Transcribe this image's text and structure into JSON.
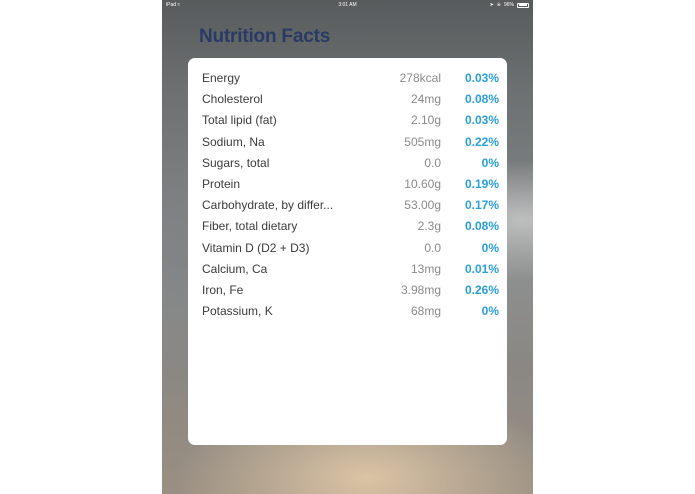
{
  "status_bar": {
    "device": "iPad",
    "wifi_icon": "wifi-icon",
    "time": "3:01 AM",
    "battery_percent": "96%",
    "battery_level": 0.96
  },
  "page": {
    "title": "Nutrition Facts"
  },
  "nutrients": [
    {
      "name": "Energy",
      "amount": "278kcal",
      "percent": "0.03%"
    },
    {
      "name": "Cholesterol",
      "amount": "24mg",
      "percent": "0.08%"
    },
    {
      "name": "Total lipid (fat)",
      "amount": "2.10g",
      "percent": "0.03%"
    },
    {
      "name": "Sodium, Na",
      "amount": "505mg",
      "percent": "0.22%"
    },
    {
      "name": "Sugars, total",
      "amount": "0.0",
      "percent": "0%"
    },
    {
      "name": "Protein",
      "amount": "10.60g",
      "percent": "0.19%"
    },
    {
      "name": "Carbohydrate, by differ...",
      "amount": "53.00g",
      "percent": "0.17%"
    },
    {
      "name": "Fiber, total dietary",
      "amount": "2.3g",
      "percent": "0.08%"
    },
    {
      "name": "Vitamin D (D2 + D3)",
      "amount": "0.0",
      "percent": "0%"
    },
    {
      "name": "Calcium, Ca",
      "amount": "13mg",
      "percent": "0.01%"
    },
    {
      "name": "Iron, Fe",
      "amount": "3.98mg",
      "percent": "0.26%"
    },
    {
      "name": "Potassium, K",
      "amount": "68mg",
      "percent": "0%"
    }
  ],
  "colors": {
    "title": "#2a3a66",
    "percent": "#2a9fd8",
    "card": "#ffffff"
  }
}
